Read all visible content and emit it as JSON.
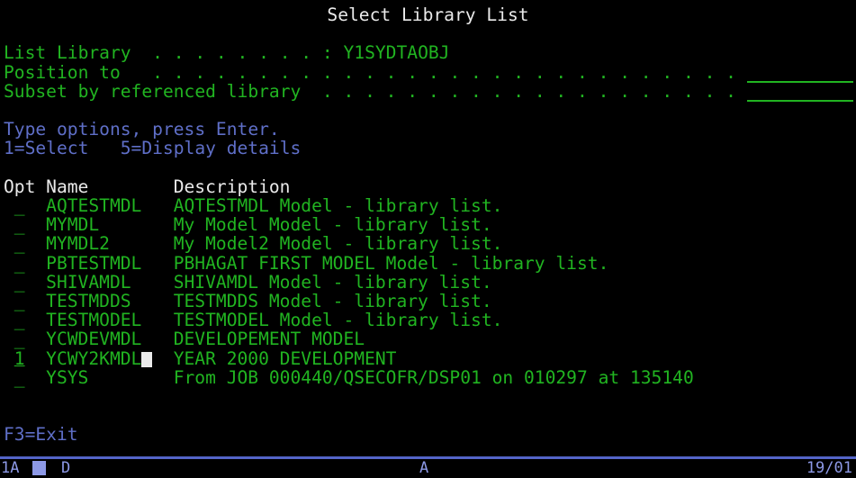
{
  "colors": {
    "green": "#21b421",
    "blue": "#5f6fc8",
    "white": "#eaeaea",
    "oia_text": "#8d99e6",
    "oia_line": "#5465c8",
    "cursor": "#eaeaea",
    "bg": "#000000"
  },
  "screen": {
    "title": "Select Library List",
    "list_library": {
      "label": "List Library",
      "leader": "  . . . . . . . . : ",
      "value": "Y1SYDTAOBJ"
    },
    "position_to": {
      "label": "Position to",
      "leader": "   . . . . . . . . . . . . . . . . . . . . . . . . . . . . ",
      "value": ""
    },
    "subset": {
      "label": "Subset by referenced library",
      "leader": "  . . . . . . . . . . . . . . . . . . . . ",
      "value": ""
    },
    "instructions": {
      "line1": "Type options, press Enter.",
      "option1": "1=Select",
      "option2": "5=Display details"
    },
    "table": {
      "headers": {
        "opt": "Opt",
        "name": "Name",
        "description": "Description"
      },
      "rows": [
        {
          "opt": "_",
          "name": "AQTESTMDL",
          "description": "AQTESTMDL Model - library list."
        },
        {
          "opt": "_",
          "name": "MYMDL",
          "description": "My Model Model - library list."
        },
        {
          "opt": "_",
          "name": "MYMDL2",
          "description": "My Model2 Model - library list."
        },
        {
          "opt": "_",
          "name": "PBTESTMDL",
          "description": "PBHAGAT FIRST MODEL Model - library list."
        },
        {
          "opt": "_",
          "name": "SHIVAMDL",
          "description": "SHIVAMDL Model - library list."
        },
        {
          "opt": "_",
          "name": "TESTMDDS",
          "description": "TESTMDDS Model - library list."
        },
        {
          "opt": "_",
          "name": "TESTMODEL",
          "description": "TESTMODEL Model - library list."
        },
        {
          "opt": "_",
          "name": "YCWDEVMDL",
          "description": "DEVELOPEMENT MODEL"
        },
        {
          "opt": "1",
          "name": "YCWY2KMDL",
          "description": "YEAR 2000 DEVELOPMENT"
        },
        {
          "opt": "_",
          "name": "YSYS",
          "description": "From JOB 000440/QSECOFR/DSP01 on 010297 at 135140"
        }
      ]
    },
    "function_keys": "F3=Exit",
    "oia": {
      "left": "1A",
      "indicator_d": "D",
      "indicator_a": "A",
      "cursor_pos": "19/01"
    }
  }
}
